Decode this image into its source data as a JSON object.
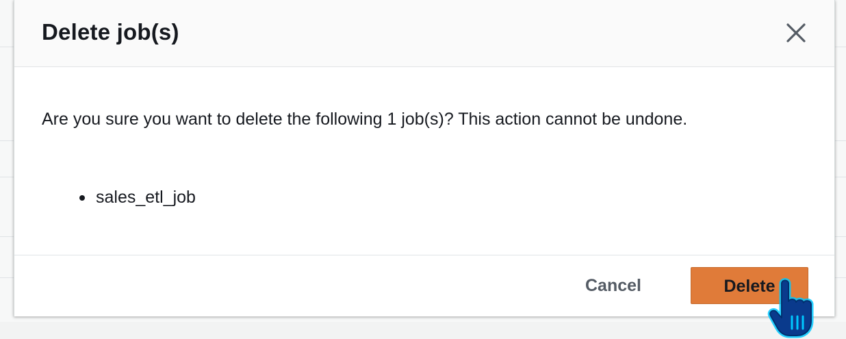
{
  "dialog": {
    "title": "Delete job(s)",
    "message": "Are you sure you want to delete the following 1 job(s)? This action cannot be undone.",
    "jobs": [
      "sales_etl_job"
    ]
  },
  "footer": {
    "cancel_label": "Cancel",
    "delete_label": "Delete"
  },
  "icons": {
    "close": "close-icon",
    "cursor": "hand-pointer-icon"
  },
  "colors": {
    "primary_button": "#e07b39",
    "cursor_highlight": "#00c8ff"
  }
}
